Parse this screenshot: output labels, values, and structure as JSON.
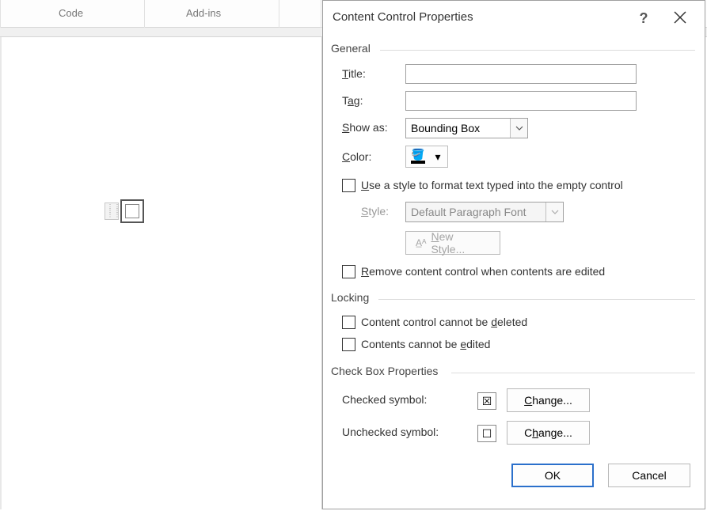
{
  "ribbon": {
    "tab1": "Code",
    "tab2": "Add-ins"
  },
  "dialog": {
    "title": "Content Control Properties",
    "sections": {
      "general": "General",
      "locking": "Locking",
      "checkbox_props": "Check Box Properties"
    },
    "labels": {
      "title_field": "Title:",
      "tag_field": "Tag:",
      "show_as": "Show as:",
      "color": "Color:",
      "style": "Style:",
      "checked_symbol": "Checked symbol:",
      "unchecked_symbol": "Unchecked symbol:"
    },
    "values": {
      "title_field": "",
      "tag_field": "",
      "show_as": "Bounding Box",
      "style": "Default Paragraph Font",
      "checked_symbol": "☒",
      "unchecked_symbol": "☐"
    },
    "checkboxes": {
      "use_style": "Use a style to format text typed into the empty control",
      "remove_control": "Remove content control when contents are edited",
      "cannot_delete": "Content control cannot be deleted",
      "cannot_edit": "Contents cannot be edited"
    },
    "buttons": {
      "new_style": "New Style...",
      "change": "Change...",
      "ok": "OK",
      "cancel": "Cancel"
    }
  }
}
